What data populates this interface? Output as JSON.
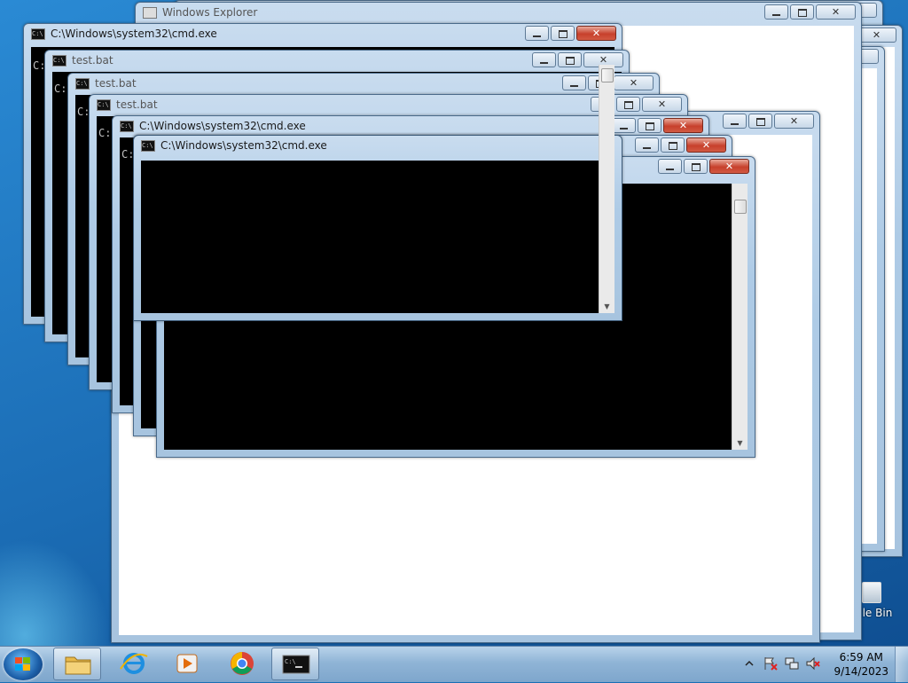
{
  "explorer": {
    "title": "Windows Explorer"
  },
  "windows": {
    "cmd_a": {
      "title": "C:\\Windows\\system32\\cmd.exe",
      "prompt": "C:"
    },
    "bat_1": {
      "title": "test.bat",
      "prompt": "C:"
    },
    "bat_2": {
      "title": "test.bat",
      "prompt": "C:"
    },
    "bat_3": {
      "title": "test.bat",
      "prompt": "C:"
    },
    "cmd_b": {
      "title": "C:\\Windows\\system32\\cmd.exe",
      "prompt": "C:"
    },
    "cmd_c": {
      "title": "C:\\Windows\\system32\\cmd.exe"
    }
  },
  "desktop": {
    "recycle_bin_label": "cle Bin"
  },
  "taskbar": {
    "pinned": [
      "folder-icon",
      "internet-explorer-icon",
      "media-player-icon",
      "chrome-icon",
      "cmd-icon"
    ],
    "clock_time": "6:59 AM",
    "clock_date": "9/14/2023",
    "tray_icons": [
      "show-hidden-icons-chevron",
      "action-center-flag-icon",
      "network-icon",
      "volume-muted-icon"
    ]
  },
  "colors": {
    "close_button": "#c7402c",
    "console_bg": "#000000",
    "window_frame": "#aecbe6"
  }
}
